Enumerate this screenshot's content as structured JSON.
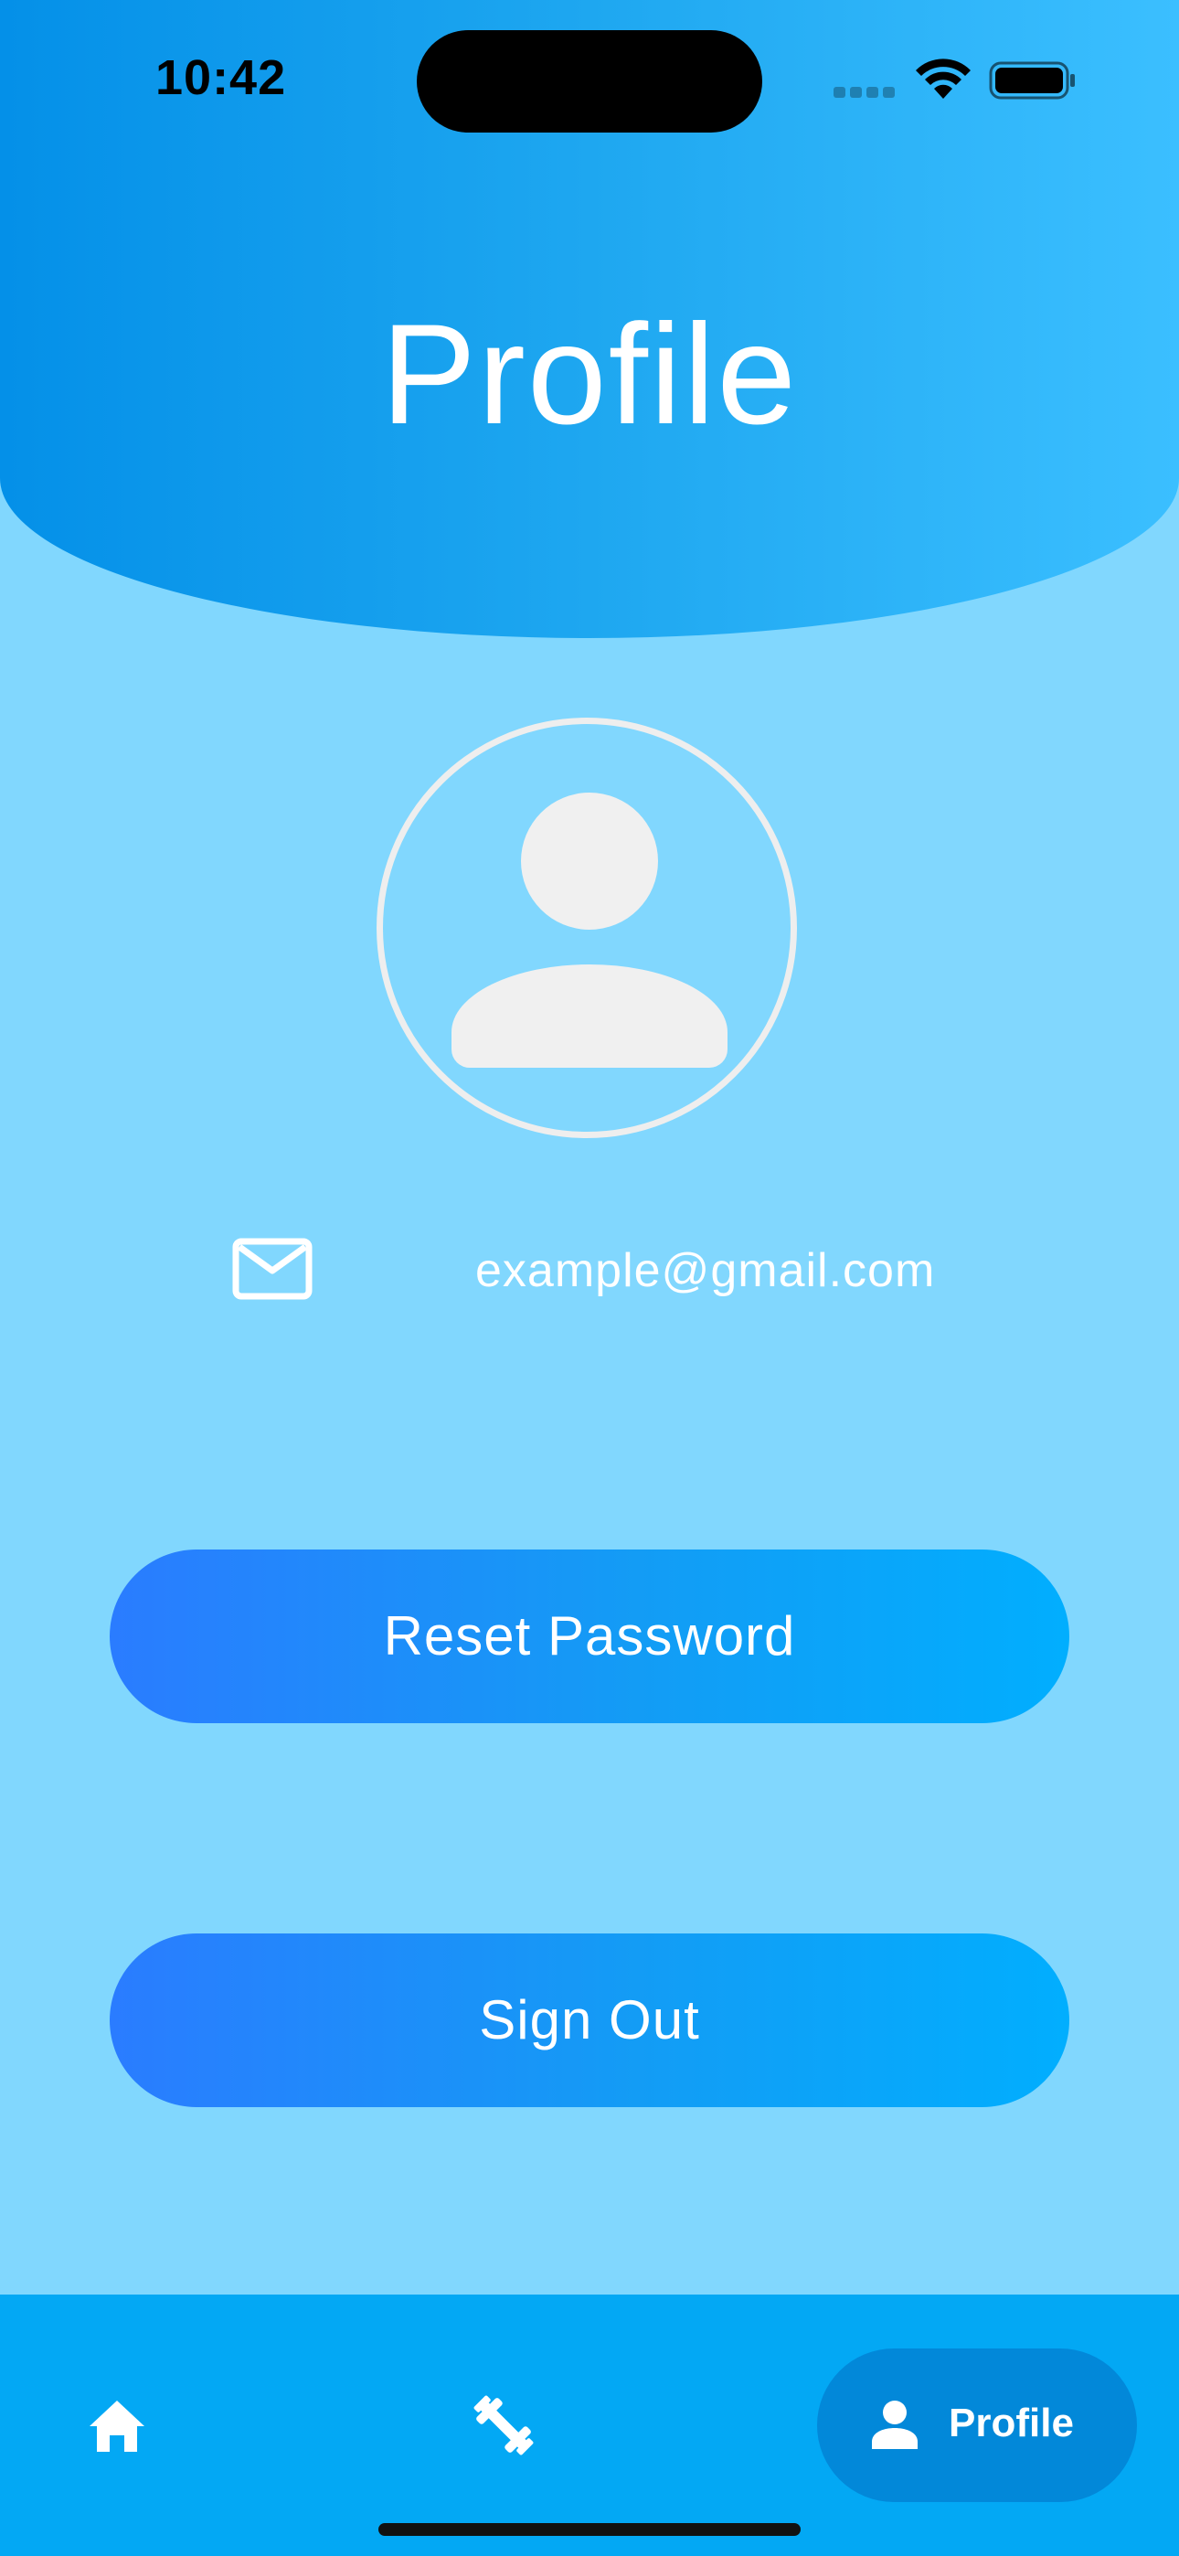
{
  "status_bar": {
    "time": "10:42"
  },
  "header": {
    "title": "Profile"
  },
  "profile": {
    "avatar_icon": "person-icon",
    "email_icon": "mail-icon",
    "email": "example@gmail.com"
  },
  "actions": {
    "reset_password_label": "Reset Password",
    "sign_out_label": "Sign Out"
  },
  "tab_bar": {
    "items": [
      {
        "icon": "home-icon",
        "label": ""
      },
      {
        "icon": "dumbbell-icon",
        "label": ""
      },
      {
        "icon": "person-icon",
        "label": "Profile",
        "selected": true
      }
    ]
  },
  "colors": {
    "background": "#81d7fe",
    "header_gradient_start": "#0490e8",
    "header_gradient_end": "#3bbfff",
    "button_gradient_start": "#2a7cff",
    "button_gradient_end": "#01aefe",
    "tab_bar": "#03a8f4",
    "tab_selected": "#0288d9"
  }
}
